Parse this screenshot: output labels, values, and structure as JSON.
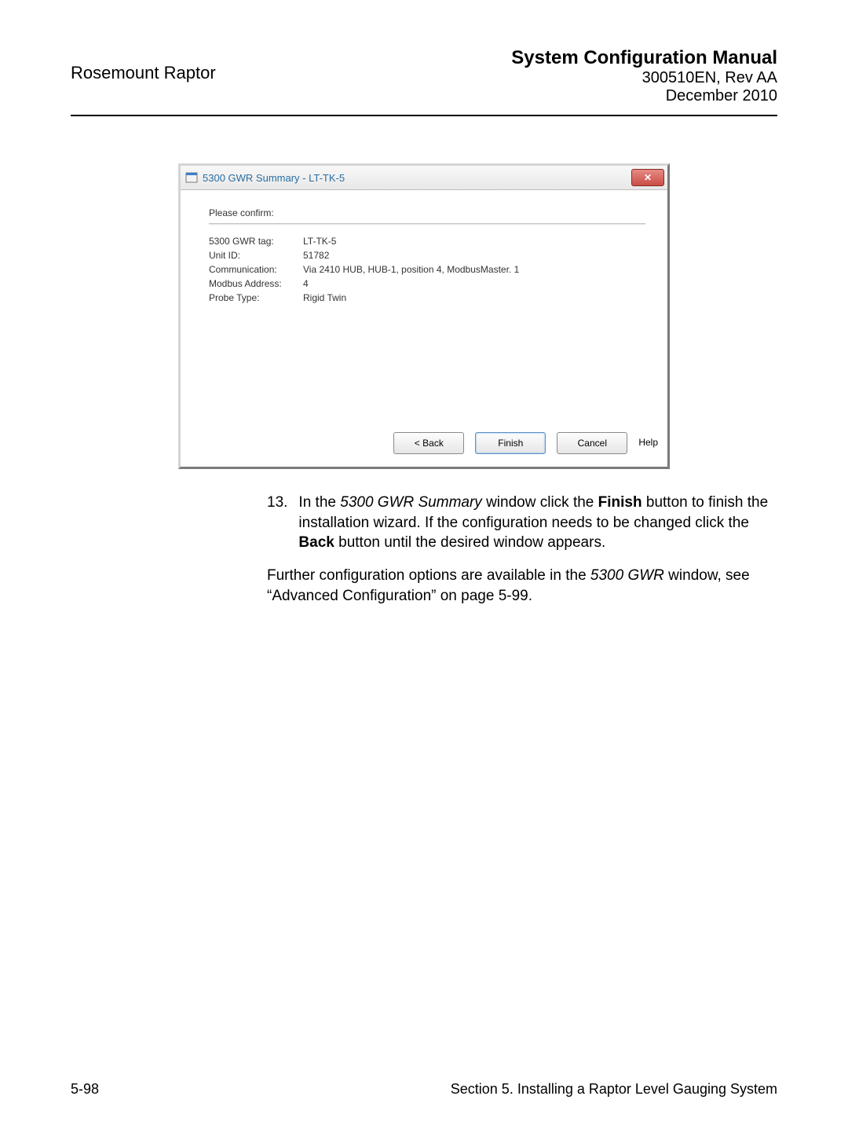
{
  "header": {
    "product": "Rosemount Raptor",
    "title": "System Configuration Manual",
    "revision": "300510EN, Rev AA",
    "date": "December 2010"
  },
  "dialog": {
    "title": "5300 GWR Summary - LT-TK-5",
    "confirm_label": "Please confirm:",
    "fields": {
      "tag_label": "5300 GWR tag:",
      "tag_value": "LT-TK-5",
      "unit_label": "Unit ID:",
      "unit_value": "51782",
      "comm_label": "Communication:",
      "comm_value": "Via 2410 HUB,  HUB-1, position  4, ModbusMaster. 1",
      "modbus_label": "Modbus Address:",
      "modbus_value": "4",
      "probe_label": "Probe Type:",
      "probe_value": "Rigid Twin"
    },
    "buttons": {
      "back": "< Back",
      "finish": "Finish",
      "cancel": "Cancel",
      "help": "Help"
    }
  },
  "step": {
    "num": "13.",
    "text_pre": "In the ",
    "text_em1": "5300 GWR Summary",
    "text_mid1": " window click the ",
    "text_b1": "Finish",
    "text_mid2": " button to finish the installation wizard. If the configuration needs to be changed click the ",
    "text_b2": "Back",
    "text_post": " button until the desired window appears."
  },
  "further": {
    "pre": "Further configuration options are available in the ",
    "em": "5300 GWR",
    "post": " window, see “Advanced Configuration” on page 5-99."
  },
  "footer": {
    "left": "5-98",
    "right": "Section 5. Installing a Raptor Level Gauging System"
  }
}
